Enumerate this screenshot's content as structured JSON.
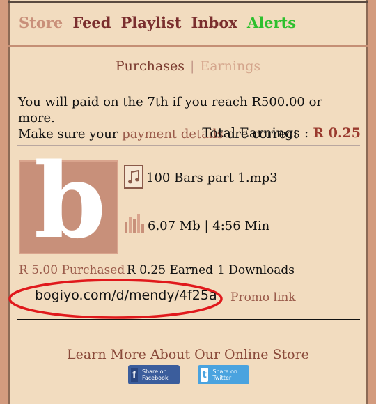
{
  "nav": {
    "store": "Store",
    "feed": "Feed",
    "playlist": "Playlist",
    "inbox": "Inbox",
    "alerts": "Alerts"
  },
  "tabs": {
    "purchases": "Purchases",
    "separator": "|",
    "earnings": "Earnings"
  },
  "info": {
    "line1": "You will paid on the 7th if you reach R500.00 or more.",
    "line2_prefix": "Make sure your ",
    "line2_link": "payment details",
    "line2_suffix": " are correct"
  },
  "total": {
    "label": "Total Earnings : ",
    "amount": "R 0.25"
  },
  "item": {
    "logo_letter": "b",
    "file_name": "100 Bars part 1.mp3",
    "size_duration": "6.07 Mb | 4:56 Min",
    "purchased": "R 5.00 Purchased",
    "earned": "R 0.25 Earned",
    "downloads": "1 Downloads",
    "promo_url": "bogiyo.com/d/mendy/4f25a",
    "promo_label": "Promo link"
  },
  "footer": {
    "learn_more": "Learn More About Our Online Store",
    "share_facebook": "Share on Facebook",
    "share_twitter": "Share on Twitter"
  },
  "colors": {
    "background": "#d39b7e",
    "panel": "#f2dcbf",
    "accent_link": "#9a5a4a",
    "alerts_green": "#2ec02e",
    "highlight_ellipse": "#e0191c"
  }
}
